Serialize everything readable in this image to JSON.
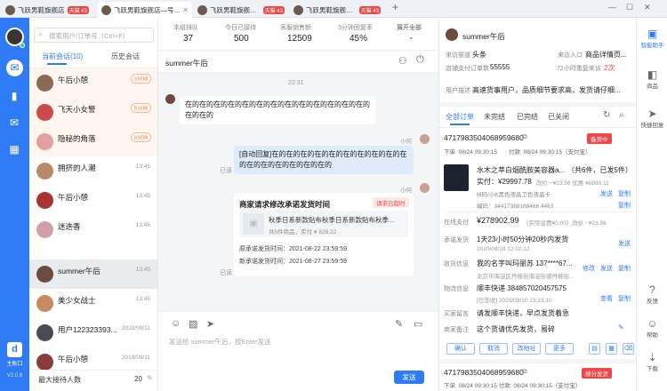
{
  "tabs": [
    {
      "label": "飞跃男鞋旗舰店",
      "badge": "天猫 43"
    },
    {
      "label": "飞跃男鞋旗舰店—号店铺",
      "badge": ""
    },
    {
      "label": "飞跃男鞋旗舰店—",
      "badge": "天猫 43"
    },
    {
      "label": "飞跃男鞋旗舰店—",
      "badge": "天猫 43"
    }
  ],
  "nav": {
    "logo_label": "主账口",
    "version": "V2.0.6"
  },
  "list": {
    "search_placeholder": "搜索用户/订单号（Ctrl+F）",
    "tab_current": "当前会话(10)",
    "tab_history": "历史会话",
    "items": [
      {
        "name": "午后小憩",
        "time": "",
        "tag": "3分钟"
      },
      {
        "name": "飞天小女警",
        "time": "",
        "tag": "5分钟"
      },
      {
        "name": "隐秘的角落",
        "time": "",
        "tag": "8分钟"
      },
      {
        "name": "拥挤的人潮",
        "time": "13:45",
        "tag": ""
      },
      {
        "name": "午后小憩",
        "time": "13:45",
        "tag": ""
      },
      {
        "name": "迷迭香",
        "time": "13:45",
        "tag": ""
      },
      {
        "name": "summer午后",
        "time": "13:45",
        "tag": ""
      },
      {
        "name": "美少女战士",
        "time": "13:45",
        "tag": ""
      },
      {
        "name": "用户122323393...",
        "time": "2019/09/11",
        "tag": ""
      },
      {
        "name": "午后小憩",
        "time": "2019/09/11",
        "tag": ""
      }
    ],
    "footer_label": "最大接待人数",
    "footer_value": "20"
  },
  "stats": [
    {
      "label": "本组排队",
      "value": "37"
    },
    {
      "label": "今日已接待",
      "value": "500"
    },
    {
      "label": "客服销售额",
      "value": "12509"
    },
    {
      "label": "3分钟回复率",
      "value": "45%"
    }
  ],
  "stats_toggle": "展开全部",
  "chat": {
    "title": "summer午后",
    "time": "22:31",
    "msg1": "在的在的在的在的在的在的在的在的在的在的在的在的在的在的在的",
    "sender": "小何",
    "msg2": "[自动回复]在的在的在的在的在的在的在的在的在的在的在的在的在的在的在的在的",
    "read1": "已读",
    "card_title": "商家请求修改承诺发货时间",
    "card_badge": "请求已超时",
    "card_product": "秋季日系新款贴布秋季日系新款贴布秋季...",
    "card_count": "共5件商品，实付 ¥ 828.22",
    "card_orig": "原承诺发货时间：2021-08-22 23:59:59",
    "card_new": "新承诺发货时间：2021-08-27 23:59:59",
    "read2": "已读",
    "input_placeholder": "发送给 summer午后，按Enter发送",
    "send": "发送"
  },
  "customer": {
    "name": "summer午后",
    "channel_label": "来访渠道",
    "channel": "头条",
    "entry_label": "来访入口",
    "entry": "商品详情页...",
    "paid_label": "店铺支付订单数",
    "paid": "55555",
    "repeat_label": "72小时重复来访",
    "repeat": "2次",
    "desc_label": "用户描述",
    "desc": "高速货事用户，品质细节要求高，发货请仔细..."
  },
  "order_tabs": [
    "全部订单",
    "未完结",
    "已完结",
    "已关闭"
  ],
  "order": {
    "id": "4717983504068959680",
    "status": "备货中",
    "placed": "下单: 08/24 09:30:15",
    "paid_time": "付款: 08/24 09:30:15（支付宝）",
    "product": "水木之萃白烟酰胺美容器a...",
    "qty": "（共6件，已发5件）",
    "actual": "实付：¥29997.78",
    "discount": "改价 −¥23.56 优惠 ¥6999.11",
    "sku": "M码/小K黑色液晶卫色液晶卡",
    "code": "编码：34417388188466 4463",
    "send_label": "发送",
    "copy_label": "复制",
    "online_label": "在线支付",
    "online_amount": "¥278902.99",
    "online_detail": "（实际运费¥0.00）改价 −¥23.56",
    "promise_label": "承诺发货",
    "promise": "1天23小时50分钟20秒内发货",
    "promise_time": "2020/09/18 12:02:12",
    "addr_label": "收货信息",
    "addr_name": "我的名字叫玛丽苏  137****67...",
    "addr_detail": "北京市海淀区丹棱街海淀街道丹棱街...",
    "edit_label": "修改",
    "logi_label": "物流信息",
    "logi": "顺丰快递  384857020457575",
    "logi_sub": "[已签收] 2020/09/10 23:23:10",
    "view_label": "查看",
    "note_label": "买家留言",
    "note": "请发顺丰快递，早点发货着急",
    "remark_label": "商家备注",
    "remark": "这个货请优先发货，易碎",
    "btn1": "确认",
    "btn2": "取消",
    "btn3": "改地址",
    "btn4": "更多",
    "order2_id": "4717983504068959680",
    "order2_status": "部分发货",
    "order2_time": "下单: 08/24 09:30:15   付款: 08/24 09:30:15（支付宝）"
  },
  "far": [
    {
      "icon": "▣",
      "label": "智能助手"
    },
    {
      "icon": "◧",
      "label": "商品"
    },
    {
      "icon": "➤",
      "label": "快捷回复"
    },
    {
      "icon": "?",
      "label": "反馈"
    },
    {
      "icon": "☺",
      "label": "帮助"
    },
    {
      "icon": "⇣",
      "label": "下载"
    }
  ],
  "colors": {
    "primary": "#2f7bf5",
    "danger": "#f04848",
    "orange": "#ff7a3c"
  }
}
